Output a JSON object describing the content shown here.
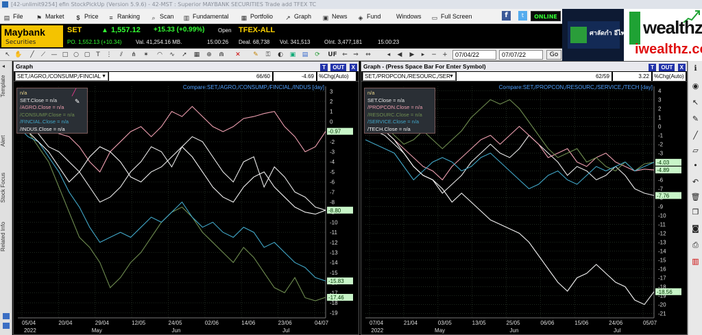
{
  "window": {
    "title": "[42-unlimit9254] efin StockPickUp (Version 5.9.6) - 42-MST : Superior MAYBANK SECURITIES Trade add TFEX TC"
  },
  "menu": [
    {
      "label": "File",
      "icon": "file-icon"
    },
    {
      "label": "Market",
      "icon": "market-icon"
    },
    {
      "label": "Price",
      "icon": "dollar-icon"
    },
    {
      "label": "Ranking",
      "icon": "ranking-icon"
    },
    {
      "label": "Scan",
      "icon": "scan-icon"
    },
    {
      "label": "Fundamental",
      "icon": "fundamental-icon"
    },
    {
      "label": "Portfolio",
      "icon": "portfolio-icon"
    },
    {
      "label": "Graph",
      "icon": "graph-icon"
    },
    {
      "label": "News",
      "icon": "news-icon"
    },
    {
      "label": "Fund",
      "icon": "fund-icon"
    },
    {
      "label": "Windows",
      "icon": ""
    },
    {
      "label": "Full Screen",
      "icon": "fullscreen-icon"
    }
  ],
  "status": {
    "online": "ONLINE",
    "facebook": "f",
    "twitter": "t"
  },
  "logo": {
    "brand": "Maybank",
    "sub": "Securities"
  },
  "ticker": {
    "set_label": "SET",
    "set_value": "1,557.12",
    "set_change": "+15.33 (+0.99%)",
    "set_state": "Open",
    "tfex_label": "TFEX-ALL",
    "po": "PO. 1,552.13 (+10.34)",
    "val": "Val. 41,254.16 MB.",
    "time1": "15:00:26",
    "deal": "Deal. 68,738",
    "vol": "Vol. 341,513",
    "oint": "OInt. 3,477,181",
    "time2": "15:00:23"
  },
  "toolbar": {
    "date_from": "07/04/22",
    "date_to": "07/07/22",
    "go_label": "Go",
    "uf_label": "UF"
  },
  "ad": {
    "brand_th": "ศาลัดกำ อีไพแนนซ์",
    "word1": "wealthz",
    "word2": "iwealthz.com"
  },
  "left_tabs": [
    "Template",
    "Alert",
    "Stock Focus",
    "Related Info"
  ],
  "colors": {
    "set": "#e8e8e8",
    "sector1": "#ee9fb0",
    "sector2": "#6f8d50",
    "sector3": "#41a7c8",
    "sector4": "#f2f2f2",
    "up": "#33ff33"
  },
  "panels": [
    {
      "title": "Graph",
      "symbol": "SET,/AGRO,/CONSUMP,/FINCIAL",
      "count": "66/60",
      "pct": "-4.69",
      "mode": "%Chg(Auto)",
      "buttons": {
        "t": "T",
        "out": "OUT",
        "x": "X"
      },
      "compare": "Compare:SET,/AGRO,/CONSUMP,/FINCIAL,/INDUS [day]",
      "legend": [
        "n/a",
        "SET.Close = n/a",
        "/AGRO.Close = n/a",
        "/CONSUMP.Close = n/a",
        "/FINCIAL.Close = n/a",
        "/INDUS.Close = n/a"
      ],
      "chart_data": {
        "type": "line",
        "y_ticks": [
          "3",
          "2",
          "1",
          "0",
          "-1",
          "-2",
          "-3",
          "-4",
          "-5",
          "-6",
          "-7",
          "-8",
          "-9",
          "-10",
          "-11",
          "-12",
          "-13",
          "-14",
          "-15",
          "-16",
          "-17",
          "-18",
          "-19"
        ],
        "ylim": [
          -19.5,
          3.5
        ],
        "x_ticks": [
          "05/04",
          "20/04",
          "29/04",
          "12/05",
          "24/05",
          "02/06",
          "14/06",
          "23/06",
          "04/07"
        ],
        "month_labels": [
          "2022",
          "May",
          "Jun",
          "Jul"
        ],
        "value_labels": [
          {
            "text": "-0.97",
            "y": -0.97
          },
          {
            "text": "-8.80",
            "y": -8.8
          },
          {
            "text": "-15.83",
            "y": -15.83
          },
          {
            "text": "-17.46",
            "y": -17.46
          }
        ],
        "series": [
          {
            "name": "SET",
            "values": [
              0.5,
              -0.5,
              -1.2,
              -2.5,
              -3.0,
              -4.0,
              -5.0,
              -6.5,
              -8.0,
              -7.5,
              -6.5,
              -5.0,
              -4.0,
              -2.5,
              -3.0,
              -4.5,
              -2.5,
              -1.5,
              -2.0,
              -3.5,
              -5.0,
              -6.0,
              -4.0,
              -3.5,
              -6.5,
              -4.5,
              -5.5,
              -7.0,
              -7.5,
              -8.5,
              -8.8
            ]
          },
          {
            "name": "/AGRO",
            "values": [
              1.5,
              1.0,
              0.2,
              -0.5,
              -1.2,
              -1.5,
              -2.5,
              -4.0,
              -5.0,
              -3.0,
              -2.0,
              -1.0,
              -0.5,
              -1.5,
              -0.5,
              1.0,
              0.5,
              1.5,
              0.5,
              -0.5,
              -1.0,
              -0.5,
              0.3,
              0.5,
              0.8,
              1.0,
              -0.5,
              -1.5,
              -3.0,
              -2.5,
              -0.97
            ]
          },
          {
            "name": "/CONSUMP",
            "values": [
              -0.5,
              -1.0,
              -2.5,
              -4.0,
              -6.5,
              -9.0,
              -11.5,
              -12.5,
              -14.0,
              -16.5,
              -15.5,
              -14.0,
              -13.0,
              -11.5,
              -10.0,
              -9.0,
              -8.5,
              -9.5,
              -11.0,
              -12.0,
              -13.0,
              -14.0,
              -12.5,
              -13.5,
              -15.0,
              -16.5,
              -17.0,
              -15.5,
              -17.5,
              -17.8,
              -17.46
            ]
          },
          {
            "name": "/FINCIAL",
            "values": [
              -0.5,
              -1.5,
              -2.0,
              -3.5,
              -5.0,
              -7.0,
              -8.5,
              -10.5,
              -12.0,
              -11.5,
              -11.0,
              -11.5,
              -10.5,
              -9.5,
              -10.0,
              -9.0,
              -8.0,
              -9.5,
              -10.5,
              -10.0,
              -11.0,
              -11.5,
              -10.5,
              -11.0,
              -12.5,
              -12.0,
              -13.0,
              -14.0,
              -14.5,
              -15.5,
              -15.83
            ]
          },
          {
            "name": "/INDUS",
            "values": [
              -0.5,
              -1.0,
              -2.0,
              -3.0,
              -4.5,
              -6.0,
              -5.0,
              -3.5,
              -2.5,
              -3.0,
              -4.0,
              -5.5,
              -6.0,
              -5.0,
              -4.5,
              -3.5,
              -2.5,
              -3.5,
              -5.0,
              -6.5,
              -7.5,
              -8.0,
              -6.5,
              -5.5,
              -5.0,
              -6.5,
              -7.5,
              -8.5,
              -9.0,
              -9.2,
              -8.8
            ]
          }
        ]
      }
    },
    {
      "title": "Graph - (Press Space Bar For Enter Symbol)",
      "symbol": "SET,/PROPCON,/RESOURC,/SER",
      "count": "62/59",
      "pct": "3.22",
      "mode": "%Chg(Auto)",
      "buttons": {
        "t": "T",
        "out": "OUT",
        "x": "X"
      },
      "compare": "Compare:SET,/PROPCON,/RESOURC,/SERVICE,/TECH [day]",
      "legend": [
        "n/a",
        "SET.Close = n/a",
        "/PROPCON.Close = n/a",
        "/RESOURC.Close = n/a",
        "/SERVICE.Close = n/a",
        "/TECH.Close = n/a"
      ],
      "chart_data": {
        "type": "line",
        "y_ticks": [
          "4",
          "3",
          "2",
          "1",
          "0",
          "-1",
          "-2",
          "-3",
          "-4",
          "-5",
          "-6",
          "-7",
          "-8",
          "-9",
          "-10",
          "-11",
          "-12",
          "-13",
          "-14",
          "-15",
          "-16",
          "-17",
          "-18",
          "-19",
          "-20",
          "-21"
        ],
        "ylim": [
          -21.5,
          4.5
        ],
        "x_ticks": [
          "07/04",
          "21/04",
          "03/05",
          "13/05",
          "25/05",
          "06/06",
          "15/06",
          "24/06",
          "05/07"
        ],
        "month_labels": [
          "2022",
          "May",
          "Jun",
          "Jul"
        ],
        "value_labels": [
          {
            "text": "-4.03",
            "y": -4.03
          },
          {
            "text": "-4.89",
            "y": -4.89
          },
          {
            "text": "-7.76",
            "y": -7.76
          },
          {
            "text": "-18.56",
            "y": -18.56
          }
        ],
        "series": [
          {
            "name": "SET",
            "values": [
              0.5,
              -0.5,
              -1.0,
              -2.0,
              -3.0,
              -4.5,
              -5.5,
              -6.0,
              -7.5,
              -6.5,
              -5.5,
              -4.0,
              -3.0,
              -2.0,
              -3.0,
              -3.5,
              -2.5,
              -1.0,
              -2.0,
              -3.0,
              -4.0,
              -5.5,
              -4.5,
              -5.0,
              -6.0,
              -5.5,
              -4.5,
              -5.5,
              -7.0,
              -7.5,
              -7.76
            ]
          },
          {
            "name": "/PROPCON",
            "values": [
              0.5,
              0.0,
              -0.5,
              -1.5,
              -2.5,
              -3.5,
              -4.5,
              -5.0,
              -6.0,
              -4.5,
              -3.5,
              -2.5,
              -1.5,
              -1.0,
              -2.0,
              -1.0,
              0.0,
              -1.0,
              -2.0,
              -3.5,
              -3.0,
              -2.5,
              -4.0,
              -4.5,
              -3.5,
              -3.0,
              -4.0,
              -4.5,
              -5.0,
              -4.8,
              -4.89
            ]
          },
          {
            "name": "/RESOURC",
            "values": [
              1.5,
              1.0,
              0.0,
              -1.0,
              -2.0,
              -1.5,
              -0.5,
              -1.5,
              -2.5,
              -1.5,
              -0.5,
              1.0,
              2.0,
              3.0,
              2.5,
              3.0,
              2.0,
              0.5,
              -1.0,
              -2.5,
              -3.5,
              -3.0,
              -2.5,
              -4.0,
              -3.5,
              -4.5,
              -5.0,
              -4.0,
              -5.0,
              -4.2,
              -4.03
            ]
          },
          {
            "name": "/SERVICE",
            "values": [
              -1.5,
              -2.0,
              -2.5,
              -3.0,
              -4.5,
              -6.0,
              -5.0,
              -4.0,
              -3.5,
              -4.0,
              -5.0,
              -4.5,
              -3.5,
              -3.0,
              -4.0,
              -5.0,
              -6.0,
              -7.0,
              -6.5,
              -5.5,
              -5.0,
              -6.0,
              -6.5,
              -5.5,
              -4.5,
              -5.0,
              -4.5,
              -4.0,
              -5.0,
              -4.5,
              -4.03
            ]
          },
          {
            "name": "/TECH",
            "values": [
              1.0,
              0.5,
              -0.5,
              -1.5,
              -3.0,
              -4.5,
              -5.5,
              -6.0,
              -7.0,
              -8.5,
              -7.5,
              -8.5,
              -9.5,
              -10.5,
              -11.0,
              -11.5,
              -12.0,
              -13.0,
              -14.5,
              -16.0,
              -17.5,
              -18.5,
              -17.0,
              -16.5,
              -15.5,
              -16.5,
              -17.5,
              -18.0,
              -19.5,
              -20.0,
              -18.56
            ]
          }
        ]
      }
    }
  ],
  "right_tools": [
    "info-icon",
    "eye-icon",
    "cursor-icon",
    "pencil-icon",
    "line-icon",
    "eraser-icon",
    "dot-icon",
    "undo-icon",
    "trash-icon",
    "copy-icon",
    "camera-icon",
    "print-icon",
    "chart-icon"
  ]
}
